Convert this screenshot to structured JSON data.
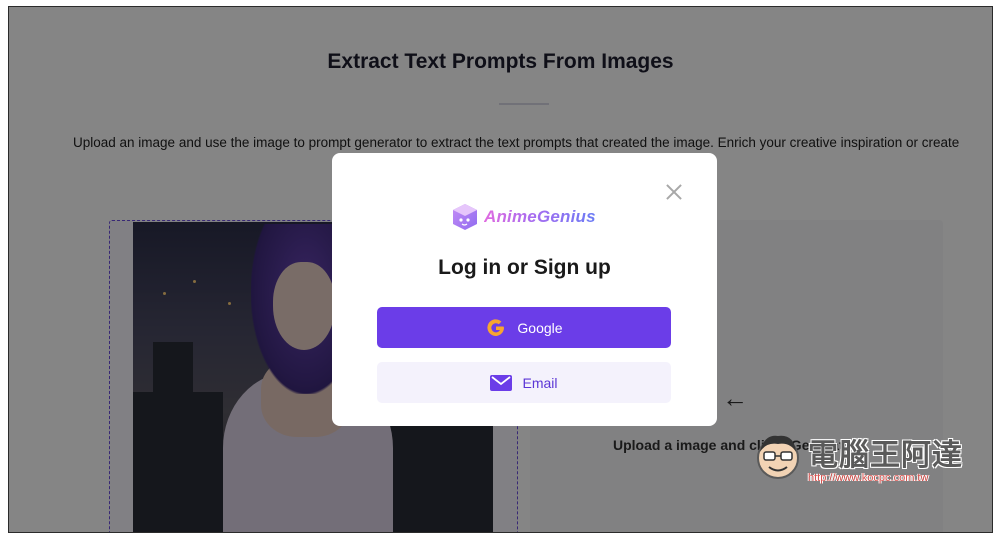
{
  "page": {
    "title": "Extract Text Prompts From Images",
    "description": "Upload an image and use the image to prompt generator to extract the text prompts that created the image. Enrich your creative inspiration or create",
    "result_hint": "Upload a image and click \"Generate\"",
    "arrow_glyph": "←"
  },
  "modal": {
    "brand_name": "AnimeGenius",
    "title": "Log in or Sign up",
    "google_label": "Google",
    "email_label": "Email",
    "icons": {
      "close": "close-icon",
      "brand": "animegenius-logo-icon",
      "google": "google-icon",
      "email": "mail-icon"
    }
  },
  "watermark": {
    "text": "電腦王阿達",
    "url": "http://www.kocpc.com.tw"
  },
  "colors": {
    "accent": "#6b3de8",
    "email_button_bg": "#f4f2fc",
    "overlay": "rgba(0,0,0,0.48)"
  }
}
